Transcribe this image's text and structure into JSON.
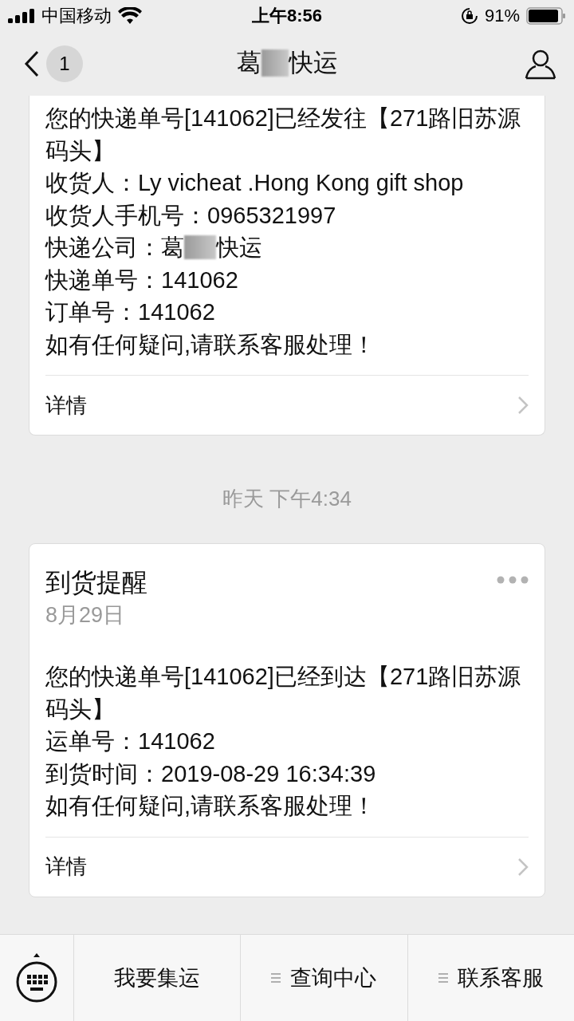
{
  "status_bar": {
    "carrier": "中国移动",
    "time": "上午8:56",
    "battery": "91%"
  },
  "nav": {
    "badge": "1",
    "title_before": "葛",
    "title_after": "快运"
  },
  "messages": [
    {
      "kind": "notice",
      "cut_top": true,
      "lines": [
        {
          "text": "您的快递单号[141062]已经发往【271路旧苏源码头】"
        },
        {
          "text": "收货人：Ly vicheat .Hong Kong gift shop"
        },
        {
          "text": "收货人手机号：0965321997"
        },
        {
          "text": "快递公司：葛",
          "redacted_after": "快运"
        },
        {
          "text": "快递单号：141062"
        },
        {
          "text": "订单号：141062"
        },
        {
          "text": "如有任何疑问,请联系客服处理！"
        }
      ],
      "details": "详情"
    },
    {
      "kind": "timestamp",
      "text": "昨天 下午4:34"
    },
    {
      "kind": "notice",
      "cut_top": false,
      "title": "到货提醒",
      "date": "8月29日",
      "lines": [
        {
          "text": "您的快递单号[141062]已经到达【271路旧苏源码头】"
        },
        {
          "text": "运单号：141062"
        },
        {
          "text": "到货时间：2019-08-29 16:34:39"
        },
        {
          "text": "如有任何疑问,请联系客服处理！"
        }
      ],
      "details": "详情"
    }
  ],
  "menu": [
    {
      "label": "我要集运",
      "submenu": false
    },
    {
      "label": "查询中心",
      "submenu": true
    },
    {
      "label": "联系客服",
      "submenu": true
    }
  ]
}
